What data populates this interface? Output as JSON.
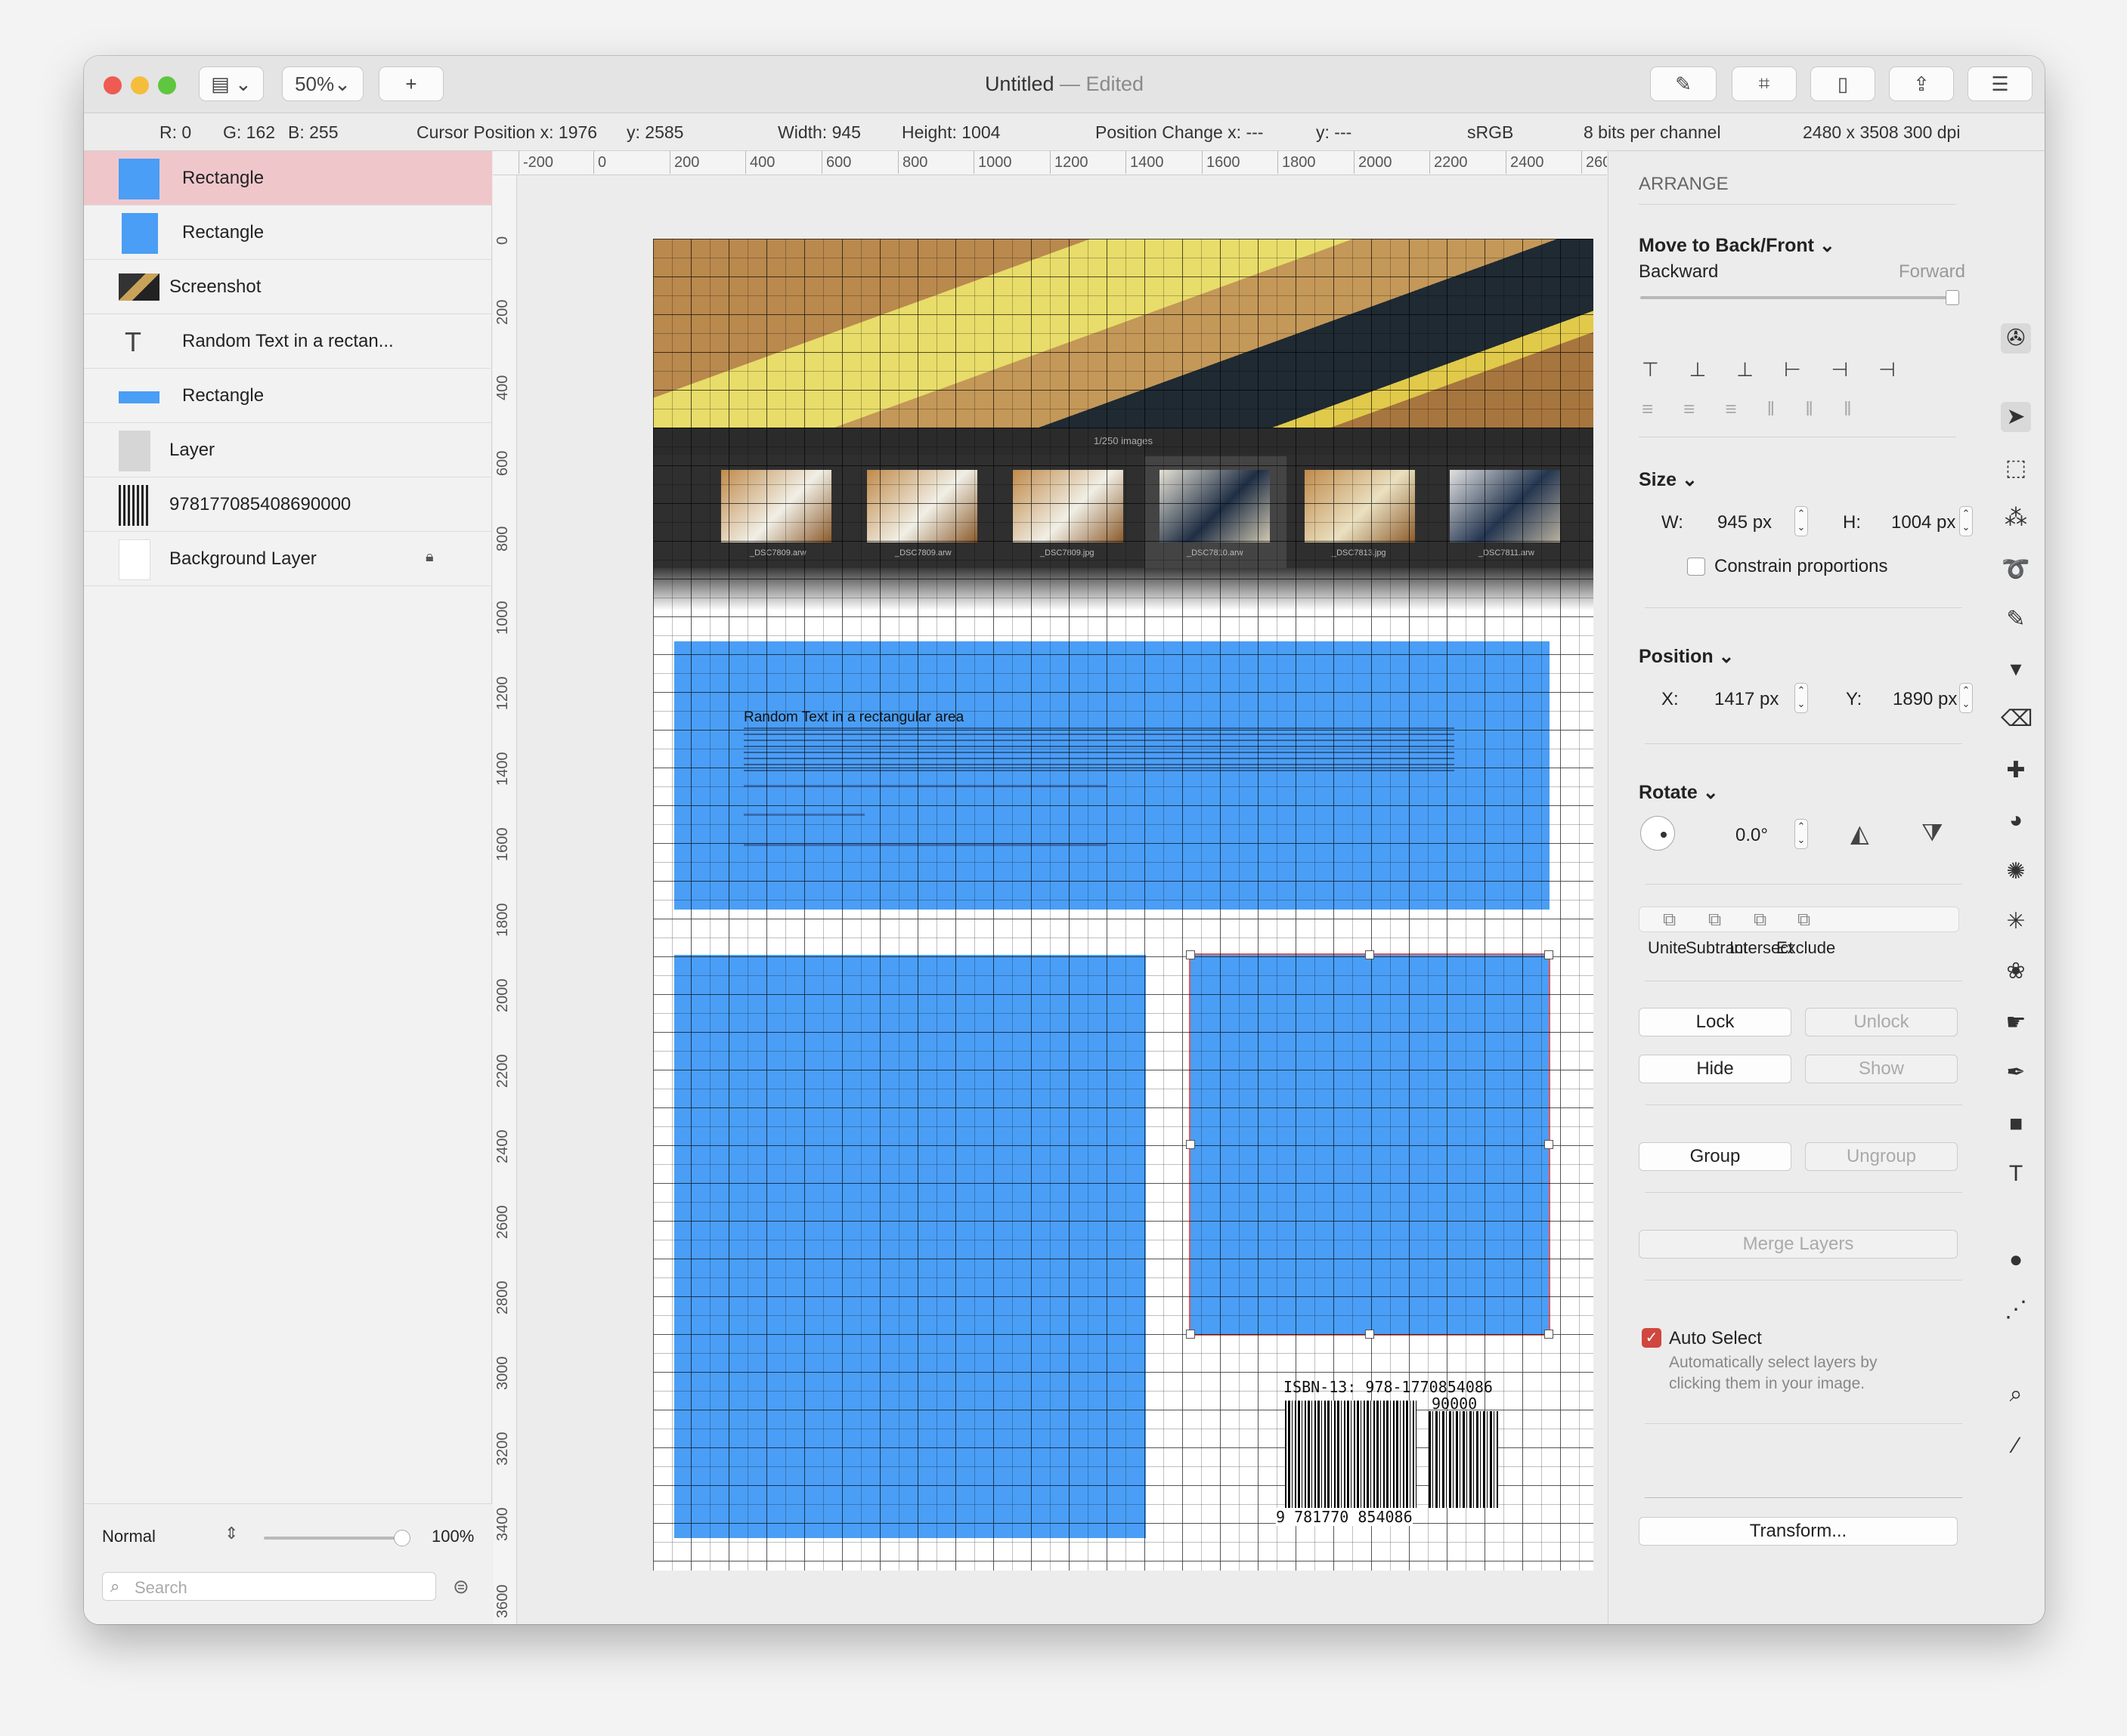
{
  "window": {
    "title": "Untitled",
    "edited": " — Edited",
    "zoom": "50%",
    "add": "+"
  },
  "info": {
    "r": "R: 0",
    "g": "G: 162",
    "b": "B: 255",
    "cursor_x": "Cursor Position x: 1976",
    "cursor_y": "y: 2585",
    "width": "Width: 945",
    "height": "Height: 1004",
    "pos_change_x": "Position Change x: ---",
    "pos_change_y": "y: ---",
    "colorspace": "sRGB",
    "depth": "8 bits per channel",
    "doc_size": "2480 x 3508 300 dpi"
  },
  "layers": [
    {
      "name": "Rectangle",
      "thumb": "blue-square",
      "selected": true
    },
    {
      "name": "Rectangle",
      "thumb": "blue-square",
      "selected": false
    },
    {
      "name": "Screenshot",
      "thumb": "image",
      "selected": false
    },
    {
      "name": "Random Text in a rectan...",
      "thumb": "text",
      "selected": false
    },
    {
      "name": "Rectangle",
      "thumb": "blue-bar",
      "selected": false
    },
    {
      "name": "Layer",
      "thumb": "gray",
      "selected": false
    },
    {
      "name": "978177085408690000",
      "thumb": "barcode",
      "selected": false
    },
    {
      "name": "Background Layer",
      "thumb": "white",
      "selected": false,
      "locked": true
    }
  ],
  "layer_footer": {
    "blend_mode": "Normal",
    "opacity": "100%",
    "search_placeholder": "Search"
  },
  "ruler": {
    "h": [
      "-200",
      "0",
      "200",
      "400",
      "600",
      "800",
      "1000",
      "1200",
      "1400",
      "1600",
      "1800",
      "2000",
      "2200",
      "2400",
      "260"
    ],
    "v": [
      "0",
      "200",
      "400",
      "600",
      "800",
      "1000",
      "1200",
      "1400",
      "1600",
      "1800",
      "2000",
      "2200",
      "2400",
      "2600",
      "2800",
      "3000",
      "3200",
      "3400",
      "3600"
    ]
  },
  "canvas": {
    "filmstrip_caption": "1/250 images",
    "film_labels": [
      "_DSC7809.arw",
      "_DSC7809.arw",
      "_DSC7809.jpg",
      "_DSC7810.arw",
      "_DSC7813.jpg",
      "_DSC7811.arw"
    ],
    "text_title": "Random Text in a rectangular area",
    "isbn": "ISBN-13: 978-1770854086",
    "barcode_addon": "90000",
    "barcode_digits": "9 781770 854086"
  },
  "arrange": {
    "header": "ARRANGE",
    "move": "Move to Back/Front",
    "backward": "Backward",
    "forward": "Forward",
    "size": "Size",
    "w_label": "W:",
    "w_value": "945 px",
    "h_label": "H:",
    "h_value": "1004 px",
    "constrain": "Constrain proportions",
    "position": "Position",
    "x_label": "X:",
    "x_value": "1417 px",
    "y_label": "Y:",
    "y_value": "1890 px",
    "rotate": "Rotate",
    "rotate_value": "0.0°",
    "bool_ops": [
      "Unite",
      "Subtract",
      "Intersect",
      "Exclude"
    ],
    "lock": "Lock",
    "unlock": "Unlock",
    "hide": "Hide",
    "show": "Show",
    "group": "Group",
    "ungroup": "Ungroup",
    "merge": "Merge Layers",
    "auto_select": "Auto Select",
    "auto_select_desc1": "Automatically select layers by",
    "auto_select_desc2": "clicking them in your image.",
    "transform": "Transform..."
  },
  "colors": {
    "accent_blue": "#4a9ef5",
    "selection_row": "#efc7cb",
    "checkbox_red": "#d0473f"
  }
}
